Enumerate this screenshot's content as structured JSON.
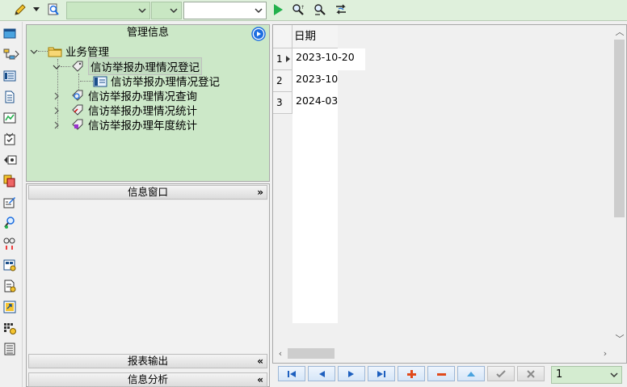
{
  "colors": {
    "toolbar_bg": "#dff0dc",
    "panel_green": "#cce8c8",
    "accent_blue": "#1d6ee0",
    "play_green": "#22b14c"
  },
  "toolbar": {
    "icons": [
      "pencil-icon",
      "magnifier-doc-icon",
      "play-icon",
      "find-icon",
      "find-next-icon",
      "refresh-icon"
    ],
    "combo1_value": "",
    "combo2_value": "",
    "combo3_value": ""
  },
  "left_strip": {
    "icons": [
      "window-icon",
      "org-tree-icon",
      "form-icon",
      "document-icon",
      "chart-icon",
      "check-doc-icon",
      "arrow-box-icon",
      "copy-icon",
      "edit-icon",
      "user-search-icon",
      "link-icon",
      "calc-icon",
      "report-icon",
      "export-icon",
      "grid-settings-icon",
      "list-icon"
    ]
  },
  "mgmt_panel": {
    "title": "管理信息",
    "tree": {
      "root": "业务管理",
      "items": [
        {
          "label": "信访举报办理情况登记",
          "child": "信访举报办理情况登记"
        },
        {
          "label": "信访举报办理情况查询"
        },
        {
          "label": "信访举报办理情况统计"
        },
        {
          "label": "信访举报办理年度统计"
        }
      ]
    }
  },
  "info_panel": {
    "title": "信息窗口",
    "report_output": "报表输出",
    "info_analysis": "信息分析"
  },
  "grid": {
    "column_header": "日期",
    "rows": [
      {
        "num": "1",
        "date": "2023-10-20"
      },
      {
        "num": "2",
        "date": "2023-10-"
      },
      {
        "num": "3",
        "date": "2024-03-"
      }
    ]
  },
  "navbar": {
    "page": "1"
  }
}
